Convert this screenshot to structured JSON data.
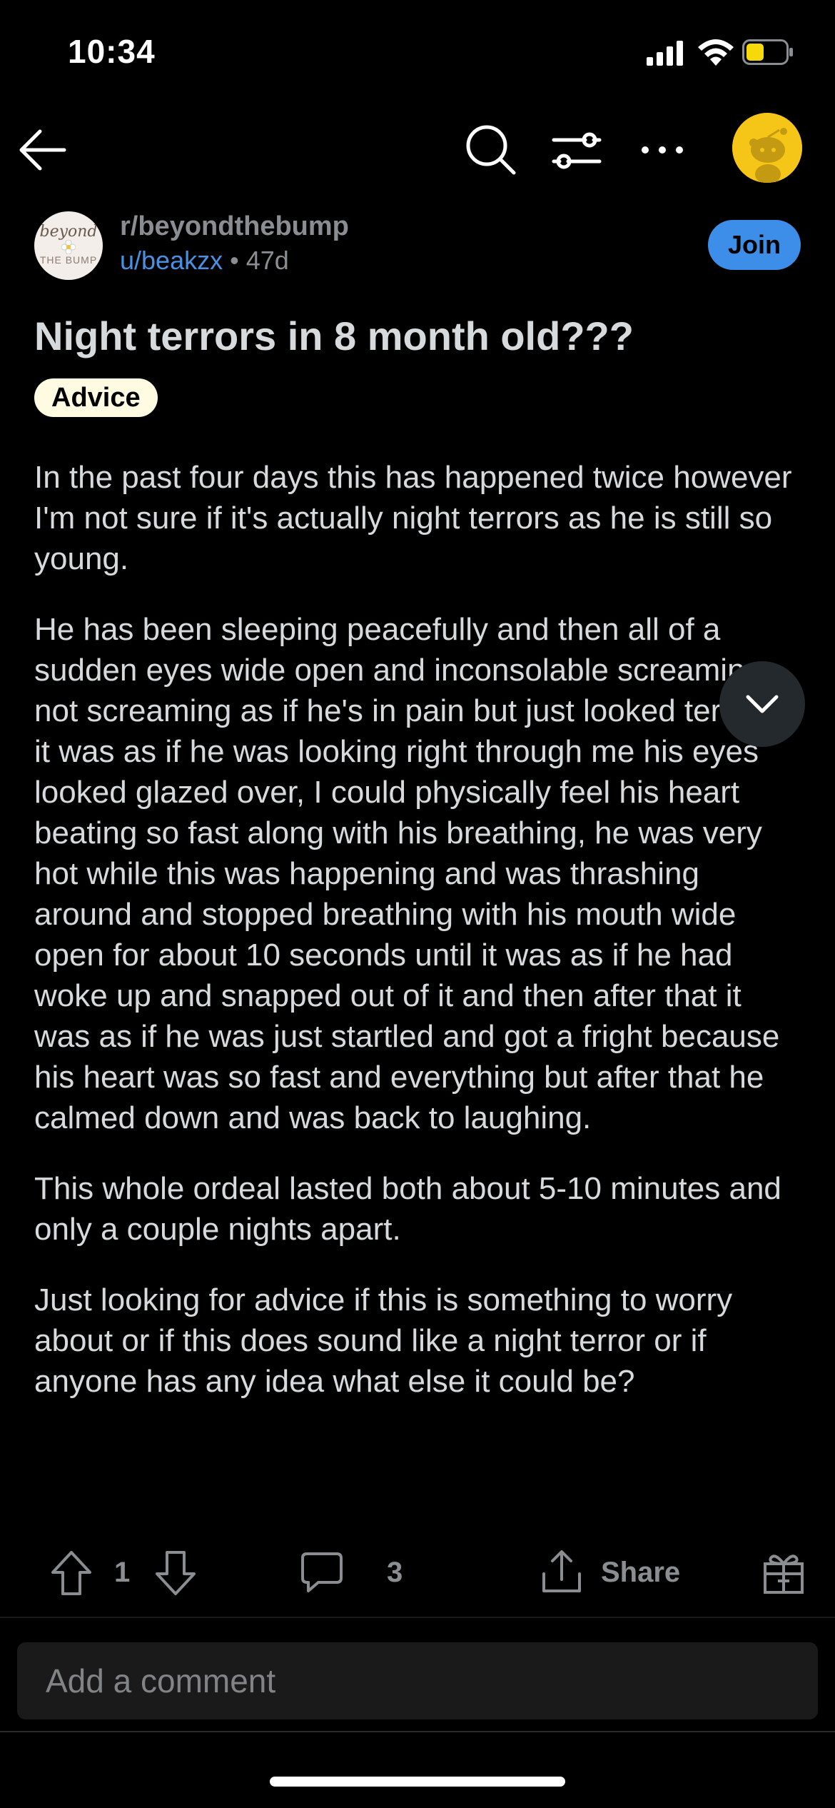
{
  "status_bar": {
    "time": "10:34"
  },
  "nav": {
    "icons": [
      "back-arrow-icon",
      "search-icon",
      "filter-icon",
      "more-icon"
    ]
  },
  "post": {
    "subreddit": "r/beyondthebump",
    "author": "u/beakzx",
    "separator": "•",
    "age": "47d",
    "join_label": "Join",
    "subreddit_logo": {
      "top_text": "beyond",
      "bottom_text": "THE BUMP"
    },
    "title": "Night terrors in 8 month old???",
    "flair": "Advice",
    "paragraphs": [
      "In the past four days this has happened twice however I'm not sure if it's actually night terrors as he is still so young.",
      "He has been sleeping peacefully and then all of a sudden eyes wide open and inconsolable screaming, not screaming as if he's in pain but just looked terrified it was as if he was looking right through me his eyes looked glazed over, I could physically feel his heart beating so fast along with his breathing, he was very hot while this was happening and was thrashing around and stopped breathing with his mouth wide open for about 10 seconds until it was as if he had woke up and snapped out of it and then after that it was as if he was just startled and got a fright because his heart was so fast and everything but after that he calmed down and was back to laughing.",
      "This whole ordeal lasted both about 5-10 minutes and only a couple nights apart.",
      "Just looking for advice if this is something to worry about or if this does sound like a night terror or if anyone has any idea what else it could be?"
    ]
  },
  "actions": {
    "vote_count": "1",
    "comment_count": "3",
    "share_label": "Share"
  },
  "composer": {
    "placeholder": "Add a comment"
  },
  "colors": {
    "background": "#000000",
    "text": "#d7dadc",
    "muted": "#8a8d91",
    "accent_blue": "#3d8ee8",
    "link_blue": "#4a90e2",
    "flair_bg": "#fffbe3",
    "avatar_yellow": "#f5c518"
  }
}
